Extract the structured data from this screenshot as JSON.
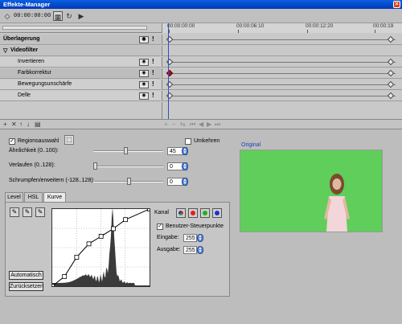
{
  "window": {
    "title": "Effekte-Manager"
  },
  "toolbar": {
    "timecode": "00:00:00:00"
  },
  "ruler": {
    "ticks": [
      "00:00:00:00",
      "00:00:06:10",
      "00:00:12:20",
      "00:00:19"
    ]
  },
  "tracks": [
    {
      "label": "Überlagerung",
      "group": true
    },
    {
      "label": "Videofilter",
      "group": true
    },
    {
      "label": "Invertieren"
    },
    {
      "label": "Farbkorrektur",
      "selected": true
    },
    {
      "label": "Bewegungsunschärfe"
    },
    {
      "label": "Delle"
    }
  ],
  "region": {
    "checkbox_label": "Regionsauswahl",
    "checked": true,
    "invert_label": "Umkehren",
    "sliders": [
      {
        "label": "Ähnlichkeit (0..100):",
        "value": "45",
        "position": 0.45
      },
      {
        "label": "Verlaufen (0..128):",
        "value": "0",
        "position": 0.0
      },
      {
        "label": "Schrumpfen/erweitern (-128..128):",
        "value": "0",
        "position": 0.5
      }
    ]
  },
  "preview": {
    "label": "Original"
  },
  "tabs": [
    "Level",
    "HSL",
    "Kurve"
  ],
  "active_tab": "Kurve",
  "curve": {
    "channel_label": "Kanal",
    "channel_colors": [
      "#e02020",
      "#20b020",
      "#2030d0"
    ],
    "user_points_label": "Benutzer-Steuerpunkte",
    "user_points_checked": true,
    "input_label": "Eingabe:",
    "input_value": "255",
    "output_label": "Ausgabe:",
    "output_value": "255",
    "auto_button": "Automatisch",
    "reset_button": "Zurücksetzen",
    "control_points": [
      [
        0,
        0
      ],
      [
        32,
        32
      ],
      [
        64,
        96
      ],
      [
        96,
        140
      ],
      [
        128,
        165
      ],
      [
        160,
        190
      ],
      [
        192,
        220
      ],
      [
        255,
        255
      ]
    ]
  },
  "colors": {
    "titlebar": "#0a4fd8",
    "green_screen": "#5fce5a",
    "keyframe_selected": "#b01010"
  }
}
